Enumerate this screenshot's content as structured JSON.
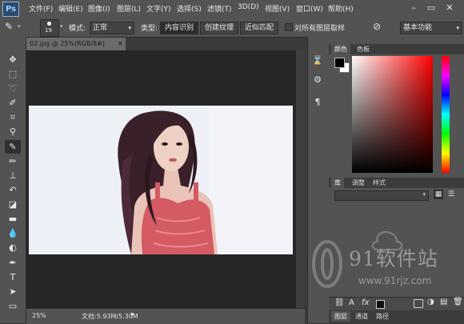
{
  "app": {
    "logo": "Ps"
  },
  "menu": {
    "items": [
      "文件(F)",
      "编辑(E)",
      "图像(I)",
      "图层(L)",
      "文字(Y)",
      "选择(S)",
      "滤镜(T)",
      "3D(D)",
      "视图(V)",
      "窗口(W)",
      "帮助(H)"
    ]
  },
  "window": {
    "min": "–",
    "max": "▭",
    "close": "✕"
  },
  "options": {
    "brush_size": "19",
    "mode_label": "模式:",
    "mode_value": "正常",
    "type_label": "类型:",
    "type_buttons": [
      "内容识别",
      "创建纹理",
      "近似匹配"
    ],
    "sample_all": "对所有图层取样",
    "workspace": "基本功能"
  },
  "document": {
    "tab_title": "02.jpg @ 25%(RGB/8#)",
    "close": "×",
    "zoom": "25%",
    "doc_size": "文档:5.93M/5.30M"
  },
  "panels": {
    "color_tabs": [
      "颜色",
      "色板"
    ],
    "library_tabs": [
      "库",
      "调整",
      "样式"
    ],
    "layer_tabs": [
      "图层",
      "通道",
      "路径"
    ]
  },
  "watermark": {
    "name": "91软件站",
    "url": "www.91rjz.com"
  },
  "colors": {
    "ui_dark": "#535353",
    "canvas_bg": "#262626",
    "image_bg": "#eef0f8",
    "dress": "#d45a63",
    "hair": "#3a2028"
  }
}
